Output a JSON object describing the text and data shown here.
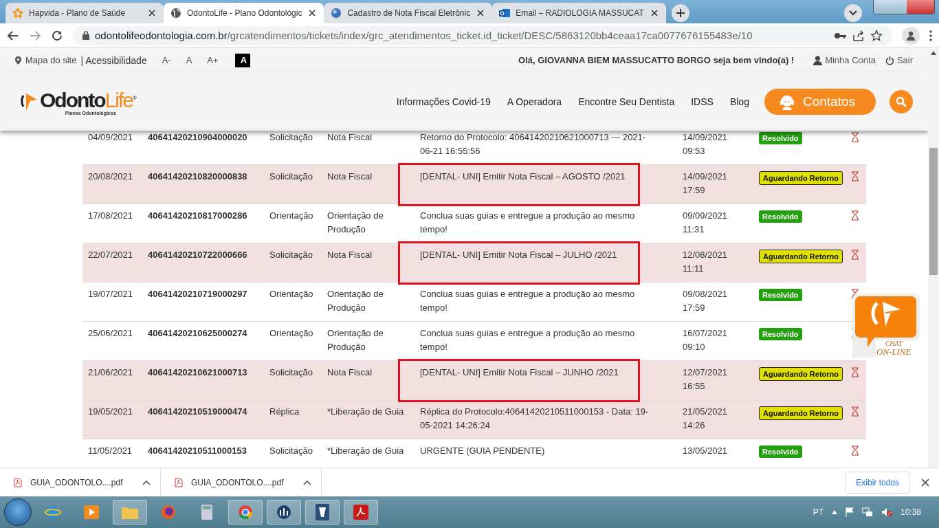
{
  "browser": {
    "tabs": [
      {
        "title": "Hapvida - Plano de Saúde",
        "selected": false
      },
      {
        "title": "OdontoLife - Plano Odontológic",
        "selected": true
      },
      {
        "title": "Cadastro de Nota Fiscal Eletrônic",
        "selected": false
      },
      {
        "title": "Email – RADIOLOGIA MASSUCAT",
        "selected": false
      }
    ],
    "address": {
      "domain": "odontolifeodontologia.com.br",
      "path": "/grcatendimentos/tickets/index/grc_atendimentos_ticket.id_ticket/DESC/5863120bb4ceaa17ca0077676155483e/10"
    }
  },
  "site": {
    "site_map": "Mapa do site",
    "accessibility": "| Acessibilidade",
    "font_buttons": [
      {
        "label": "A-",
        "selected": false
      },
      {
        "label": "A",
        "selected": false
      },
      {
        "label": "A+",
        "selected": false
      },
      {
        "label": "A",
        "selected": true
      }
    ],
    "greeting": "Olá, GIOVANNA BIEM MASSUCATTO BORGO seja bem vindo(a) !",
    "account": "Minha Conta",
    "logout": "Sair",
    "logo": {
      "dark": "Odonto",
      "light": "Life",
      "mark": "®",
      "tagline": "Planos Odontológicos"
    },
    "nav": [
      "Informações Covid-19",
      "A Operadora",
      "Encontre Seu Dentista",
      "IDSS",
      "Blog"
    ],
    "contacts": "Contatos"
  },
  "table": {
    "rows": [
      {
        "opened": "04/09/2021",
        "protocol": "40641420210904000020",
        "type": "Solicitação",
        "subject": "Nota Fiscal",
        "description": "Retorno do Protocolo: 40641420210621000713 — 2021-06-21 16:55:56",
        "updated": [
          "14/09/2021",
          "09:53"
        ],
        "status": "Resolvido",
        "kind": "resolved",
        "highlighted": false,
        "boxed": false
      },
      {
        "opened": "20/08/2021",
        "protocol": "40641420210820000838",
        "type": "Solicitação",
        "subject": "Nota Fiscal",
        "description": "[DENTAL- UNI] Emitir Nota Fiscal – AGOSTO /2021",
        "updated": [
          "14/09/2021",
          "17:59"
        ],
        "status": "Aguardando Retorno",
        "kind": "waiting",
        "highlighted": true,
        "boxed": true
      },
      {
        "opened": "17/08/2021",
        "protocol": "40641420210817000286",
        "type": "Orientação",
        "subject": "Orientação de Produção",
        "description": "Conclua suas guias e entregue a produção ao mesmo tempo!",
        "updated": [
          "09/09/2021",
          "11:31"
        ],
        "status": "Resolvido",
        "kind": "resolved",
        "highlighted": false,
        "boxed": false
      },
      {
        "opened": "22/07/2021",
        "protocol": "40641420210722000666",
        "type": "Solicitação",
        "subject": "Nota Fiscal",
        "description": "[DENTAL- UNI] Emitir Nota Fiscal – JULHO /2021",
        "updated": [
          "12/08/2021",
          "11:11"
        ],
        "status": "Aguardando Retorno",
        "kind": "waiting",
        "highlighted": true,
        "boxed": true
      },
      {
        "opened": "19/07/2021",
        "protocol": "40641420210719000297",
        "type": "Orientação",
        "subject": "Orientação de Produção",
        "description": "Conclua suas guias e entregue a produção ao mesmo tempo!",
        "updated": [
          "09/08/2021",
          "17:59"
        ],
        "status": "Resolvido",
        "kind": "resolved",
        "highlighted": false,
        "boxed": false
      },
      {
        "opened": "25/06/2021",
        "protocol": "40641420210625000274",
        "type": "Orientação",
        "subject": "Orientação de Produção",
        "description": "Conclua suas guias e entregue a produção ao mesmo tempo!",
        "updated": [
          "16/07/2021",
          "09:10"
        ],
        "status": "Resolvido",
        "kind": "resolved",
        "highlighted": false,
        "boxed": false
      },
      {
        "opened": "21/06/2021",
        "protocol": "40641420210621000713",
        "type": "Solicitação",
        "subject": "Nota Fiscal",
        "description": "[DENTAL- UNI] Emitir Nota Fiscal – JUNHO /2021",
        "updated": [
          "12/07/2021",
          "16:55"
        ],
        "status": "Aguardando Retorno",
        "kind": "waiting",
        "highlighted": true,
        "boxed": true
      },
      {
        "opened": "19/05/2021",
        "protocol": "40641420210519000474",
        "type": "Réplica",
        "subject": "*Liberação de Guia",
        "description": "Réplica do Protocolo:40641420210511000153 - Data: 19-05-2021 14:26:24",
        "updated": [
          "21/05/2021",
          "14:26"
        ],
        "status": "Aguardando Retorno",
        "kind": "waiting",
        "highlighted": true,
        "boxed": false
      },
      {
        "opened": "11/05/2021",
        "protocol": "40641420210511000153",
        "type": "Solicitação",
        "subject": "*Liberação de Guia",
        "description": "URGENTE (GUIA PENDENTE)",
        "updated": [
          "13/05/2021"
        ],
        "status": "Resolvido",
        "kind": "resolved",
        "highlighted": false,
        "boxed": false
      }
    ]
  },
  "chat": {
    "line1": "CHAT",
    "line2": "ON-LINE"
  },
  "downloads": {
    "files": [
      "GUIA_ODONTOLO....pdf",
      "GUIA_ODONTOLO....pdf"
    ],
    "show_all": "Exibir todos"
  },
  "taskbar": {
    "language": "PT",
    "time": "10:38"
  }
}
